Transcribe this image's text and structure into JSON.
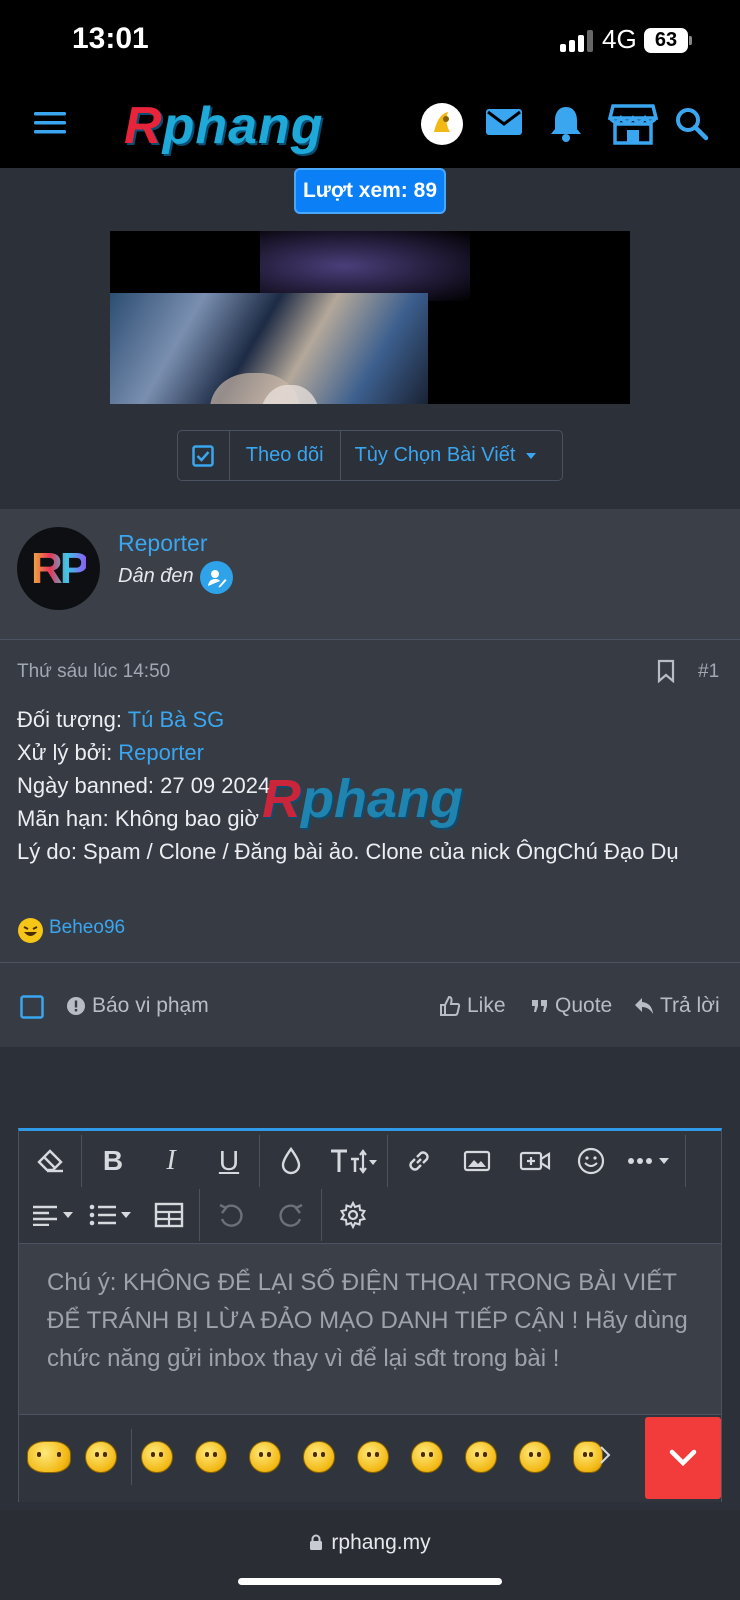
{
  "status_bar": {
    "time": "13:01",
    "network": "4G",
    "battery": "63"
  },
  "nav": {
    "logo_r": "R",
    "logo_rest": "phang"
  },
  "post_header": {
    "views": "Lượt xem: 89"
  },
  "video": {
    "icon": "video-thumbnail"
  },
  "thread_buttons": {
    "follow": "Theo dõi",
    "options": "Tùy Chọn Bài Viết"
  },
  "author": {
    "avatar_text": "RP",
    "name": "Reporter",
    "title": "Dân đen"
  },
  "post": {
    "time": "Thứ sáu lúc 14:50",
    "number": "#1",
    "lines": [
      {
        "label": "Đối tượng: ",
        "value": "Tú Bà SG",
        "link": true
      },
      {
        "label": "Xử lý bởi: ",
        "value": "Reporter",
        "link": true
      },
      {
        "label": "Ngày banned: ",
        "value": "27 09 2024",
        "link": false
      },
      {
        "label": "Mãn hạn: ",
        "value": "Không bao giờ",
        "link": false
      },
      {
        "label": "Lý do: ",
        "value": "Spam / Clone / Đăng bài ảo. Clone của nick ÔngChú Đạo Dụ",
        "link": false
      }
    ],
    "watermark_r": "R",
    "watermark_rest": "phang",
    "reaction_user": "Beheo96"
  },
  "actions": {
    "report": "Báo vi phạm",
    "like": "Like",
    "quote": "Quote",
    "reply": "Trả lời"
  },
  "editor": {
    "placeholder": "Chú ý: KHÔNG ĐỂ LẠI SỐ ĐIỆN THOẠI TRONG BÀI VIẾT ĐỂ TRÁNH BỊ LỪA ĐẢO MẠO DANH TIẾP CẬN ! Hãy dùng chức năng gửi inbox thay vì để lại sđt trong bài !"
  },
  "browser": {
    "url": "rphang.my"
  },
  "colors": {
    "accent": "#3aa6f0",
    "views_bg": "#0b7ff5",
    "danger": "#f23b3b",
    "page_bg": "#2c3038"
  }
}
